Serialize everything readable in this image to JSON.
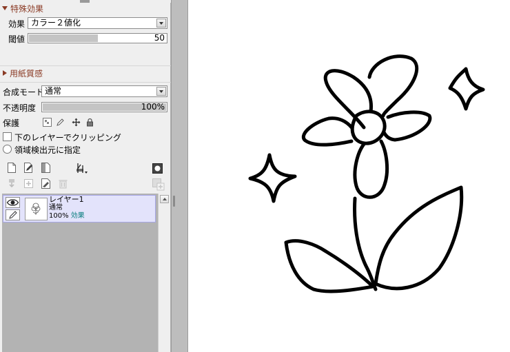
{
  "effects": {
    "section_title": "特殊効果",
    "effect_label": "効果",
    "effect_value": "カラー２値化",
    "threshold_label": "閾値",
    "threshold_value": "50",
    "threshold_fraction": 0.5
  },
  "paper": {
    "section_title": "用紙質感"
  },
  "layer_props": {
    "blend_label": "合成モード",
    "blend_value": "通常",
    "opacity_label": "不透明度",
    "opacity_value": "100%",
    "opacity_fraction": 1.0,
    "protect_label": "保護",
    "clip_label": "下のレイヤーでクリッピング",
    "select_source_label": "領域検出元に指定"
  },
  "layers": [
    {
      "name": "レイヤー1",
      "mode": "通常",
      "opacity": "100%",
      "effect": "効果"
    }
  ],
  "icons": {
    "protect": [
      "transparency-lock-icon",
      "pencil-lock-icon",
      "move-lock-icon",
      "padlock-icon"
    ],
    "layer_tools_row1": [
      "new-layer-icon",
      "new-pen-layer-icon",
      "new-layer-set-icon",
      "clear-layer-icon"
    ],
    "layer_tools_row2": [
      "transfer-down-icon",
      "merge-down-icon",
      "clear-icon",
      "trash-icon"
    ]
  },
  "colors": {
    "section_header": "#8a3a24",
    "layer_selected_bg": "#e3e3fb",
    "effect_text": "#007a7a"
  }
}
